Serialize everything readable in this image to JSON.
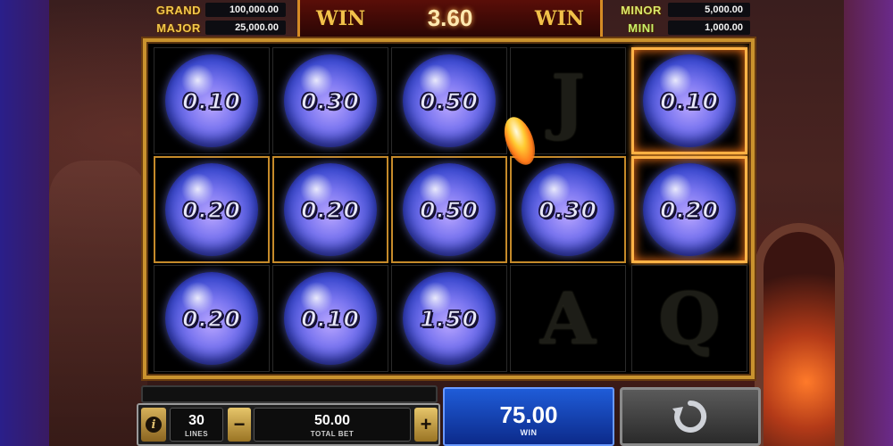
{
  "jackpots": {
    "grand": {
      "label": "GRAND",
      "value": "100,000.00"
    },
    "major": {
      "label": "MAJOR",
      "value": "25,000.00"
    },
    "minor": {
      "label": "MINOR",
      "value": "5,000.00"
    },
    "mini": {
      "label": "MINI",
      "value": "1,000.00"
    }
  },
  "win_banner": {
    "left_word": "WIN",
    "amount": "3.60",
    "right_word": "WIN"
  },
  "reels": {
    "rows": [
      [
        "0.10",
        "0.30",
        "0.50",
        "J",
        "0.10"
      ],
      [
        "0.20",
        "0.20",
        "0.50",
        "0.30",
        "0.20"
      ],
      [
        "0.20",
        "0.10",
        "1.50",
        "A",
        "Q"
      ]
    ]
  },
  "controls": {
    "lines_value": "30",
    "lines_label": "LINES",
    "minus_label": "−",
    "plus_label": "+",
    "bet_value": "50.00",
    "bet_label": "TOTAL BET",
    "win_value": "75.00",
    "win_label": "WIN",
    "info_label": "i"
  },
  "icons": {
    "info": "info-icon",
    "spin": "spin-refresh-icon",
    "fireball": "fireball-icon"
  },
  "colors": {
    "frame_gold": "#c9922e",
    "orb_blue": "#3d4bd0",
    "win_blue": "#1f5cd8"
  }
}
